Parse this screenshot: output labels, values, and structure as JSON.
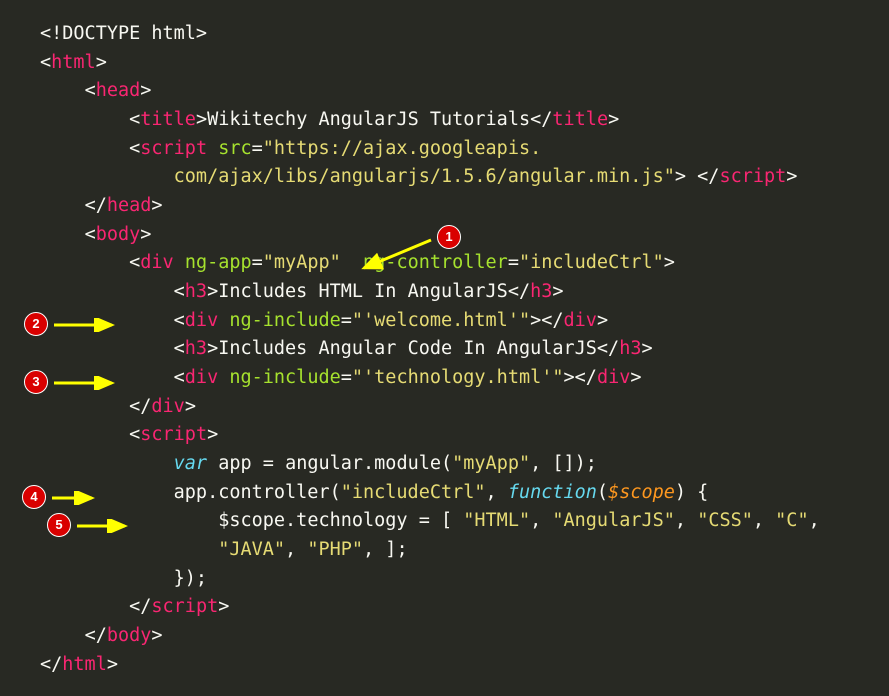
{
  "doctype": "<!DOCTYPE html>",
  "html_open": "html",
  "head_open": "head",
  "title_tag": "title",
  "title_text": "Wikitechy AngularJS Tutorials",
  "script_tag": "script",
  "src_attr": "src",
  "src_val_line1": "\"https://ajax.googleapis.",
  "src_val_line2": "com/ajax/libs/angularjs/1.5.6/angular.min.js\"",
  "head_close": "head",
  "body_tag": "body",
  "div_tag": "div",
  "ngapp_attr": "ng-app",
  "ngapp_val": "\"myApp\"",
  "ngctrl_attr": "ng-controller",
  "ngctrl_val": "\"includeCtrl\"",
  "h3_tag": "h3",
  "h3_text1": "Includes HTML In AngularJS",
  "nginclude_attr": "ng-include",
  "nginclude_val1": "\"'welcome.html'\"",
  "h3_text2": "Includes Angular Code In AngularJS",
  "nginclude_val2": "\"'technology.html'\"",
  "var_kw": "var",
  "app_name": "app",
  "eq": " = ",
  "angular_module": "angular.module(",
  "module_name": "\"myApp\"",
  "module_args": ", []);",
  "controller_call": "app.controller(",
  "controller_name": "\"includeCtrl\"",
  "comma": ", ",
  "function_kw": "function",
  "func_arg": "$scope",
  "brace_open": ") {",
  "scope_assign": "$scope.technology = [ ",
  "arr1": "\"HTML\"",
  "arr2": "\"AngularJS\"",
  "arr3": "\"CSS\"",
  "arr4": "\"C\"",
  "arr5": "\"JAVA\"",
  "arr6": "\"PHP\"",
  "arr_close": ", ];",
  "brace_close": "});",
  "badges": {
    "b1": "1",
    "b2": "2",
    "b3": "3",
    "b4": "4",
    "b5": "5"
  }
}
